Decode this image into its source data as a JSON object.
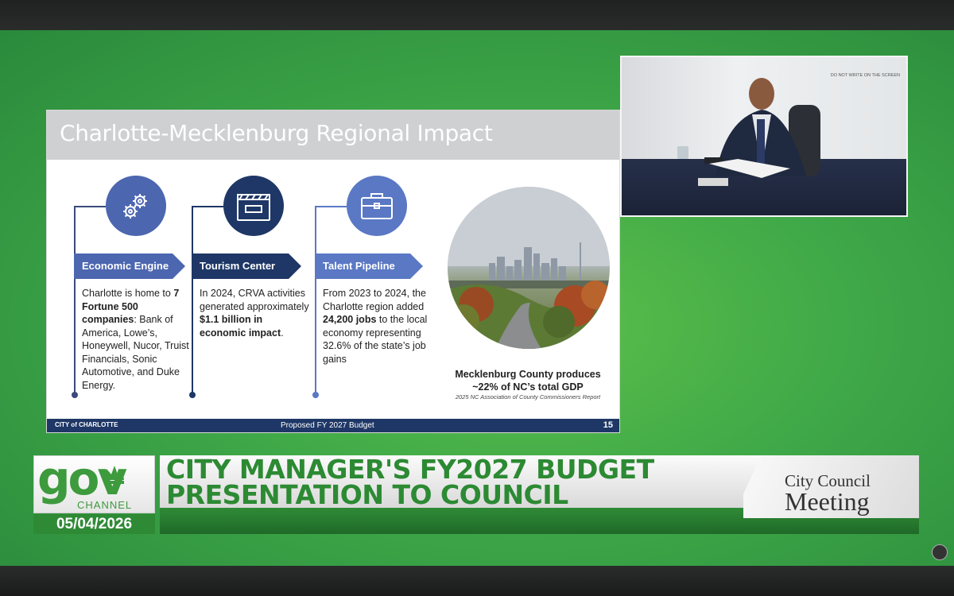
{
  "slide": {
    "title": "Charlotte-Mecklenburg Regional Impact",
    "columns": [
      {
        "icon": "gears-icon",
        "heading": "Economic Engine",
        "text_pre": "Charlotte is home to ",
        "text_bold": "7 Fortune 500 companies",
        "text_post": ": Bank of America, Lowe’s, Honeywell, Nucor, Truist Financials, Sonic Automotive, and Duke Energy."
      },
      {
        "icon": "clapperboard-icon",
        "heading": "Tourism Center",
        "text_pre": "In 2024, CRVA activities generated approximately ",
        "text_bold": "$1.1 billion in economic impact",
        "text_post": "."
      },
      {
        "icon": "briefcase-icon",
        "heading": "Talent Pipeline",
        "text_pre": "From 2023 to 2024, the Charlotte region added ",
        "text_bold": "24,200 jobs",
        "text_post": " to the local economy representing 32.6% of the state’s job gains"
      }
    ],
    "gdp_line1": "Mecklenburg County produces",
    "gdp_line2": "~22% of NC’s total GDP",
    "gdp_source": "2025 NC Association of County Commissioners Report",
    "footer_logo": "CITY of CHARLOTTE",
    "footer_center": "Proposed FY 2027 Budget",
    "page_number": "15"
  },
  "camera": {
    "wall_sign": "DO NOT WRITE ON THE SCREEN"
  },
  "lower_third": {
    "logo_gov": "gov",
    "logo_channel": "CHANNEL",
    "date": "05/04/2026",
    "title_line1": "CITY MANAGER'S FY2027 BUDGET",
    "title_line2": "PRESENTATION TO COUNCIL",
    "right_line1": "City Council",
    "right_line2": "Meeting"
  },
  "colors": {
    "accent_green": "#2f8a36",
    "col1": "#4c66b0",
    "col2": "#1e3766",
    "col3": "#5a78c4"
  }
}
